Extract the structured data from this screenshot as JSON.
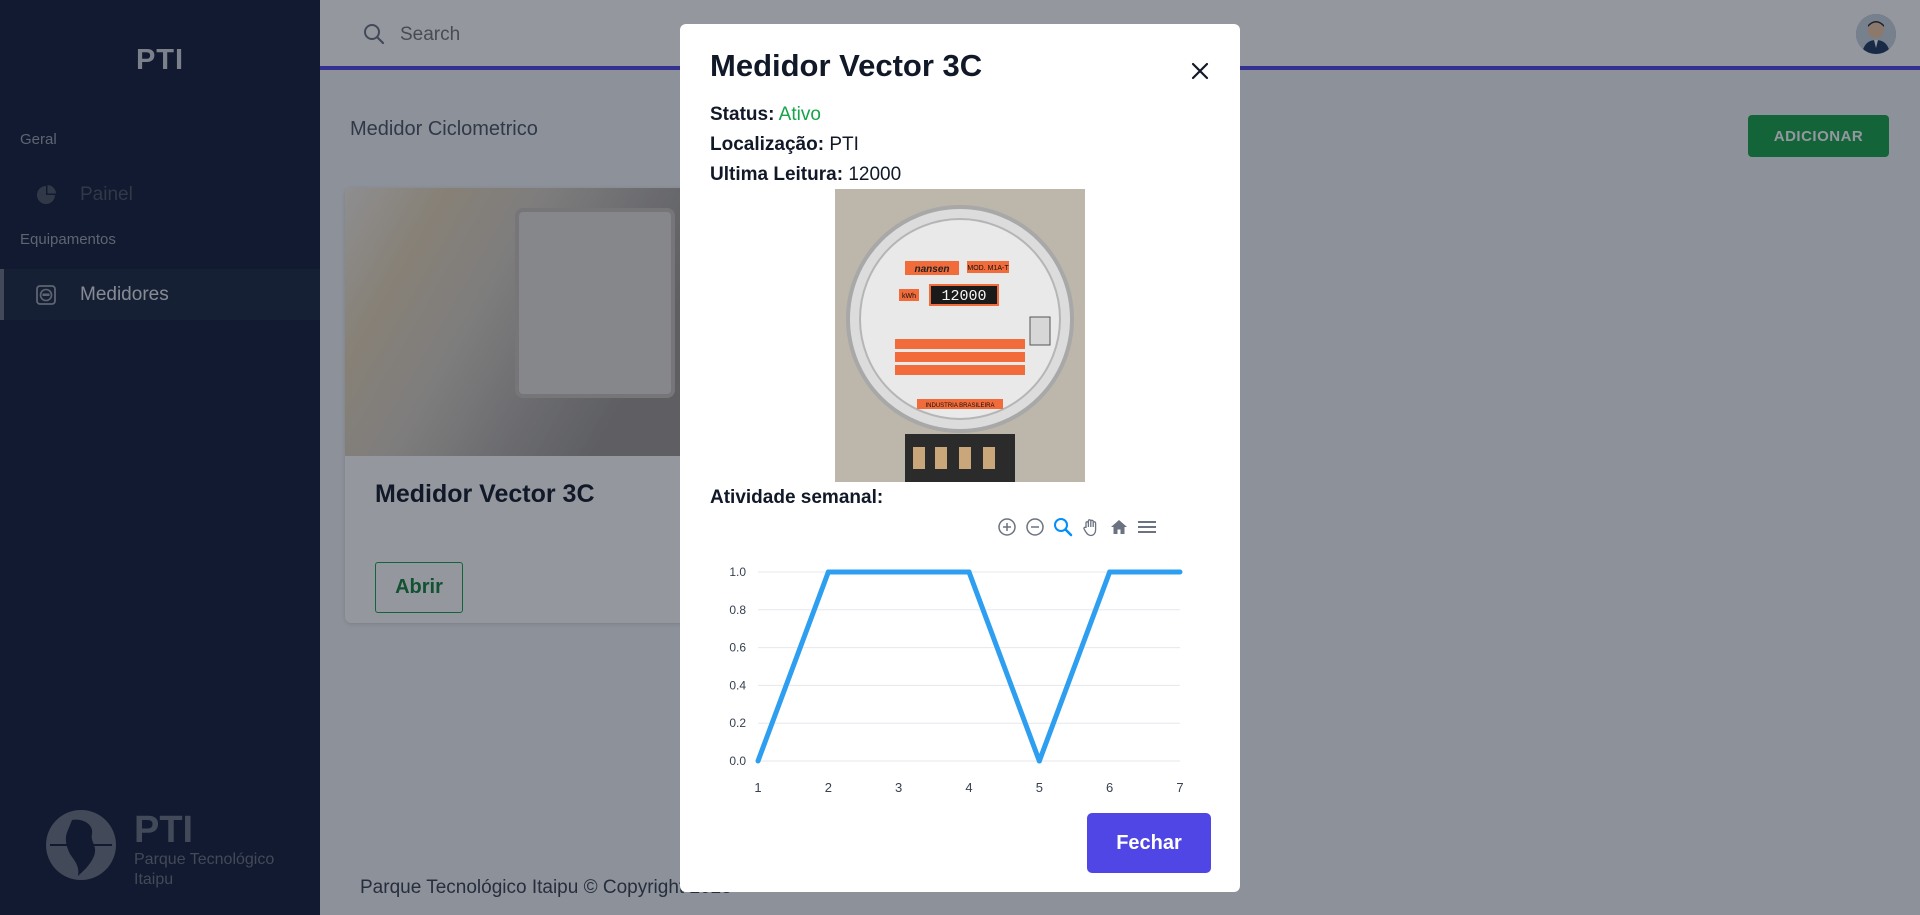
{
  "sidebar": {
    "brand": "PTI",
    "sections": [
      {
        "title": "Geral",
        "items": [
          {
            "label": "Painel",
            "icon": "pie-chart-icon",
            "state": "disabled"
          }
        ]
      },
      {
        "title": "Equipamentos",
        "items": [
          {
            "label": "Medidores",
            "icon": "meter-icon",
            "state": "active"
          }
        ]
      }
    ],
    "logo": {
      "name": "PTI",
      "line1": "Parque Tecnológico",
      "line2": "Itaipu"
    }
  },
  "header": {
    "search_placeholder": "Search",
    "accent_color": "#4f46e5"
  },
  "main": {
    "title": "Medidor Ciclometrico",
    "add_button": "ADICIONAR",
    "card": {
      "title": "Medidor Vector 3C",
      "button": "Abrir"
    },
    "footer": "Parque Tecnológico Itaipu © Copyright 2023"
  },
  "modal": {
    "title": "Medidor Vector 3C",
    "status_label": "Status:",
    "status_value": "Ativo",
    "location_label": "Localização:",
    "location_value": "PTI",
    "reading_label": "Ultima Leitura:",
    "reading_value": "12000",
    "weekly_label": "Atividade semanal:",
    "close_button": "Fechar",
    "photo_meter_reading": "12000",
    "photo_labels": {
      "brand": "nansen",
      "model": "MOD. M1A-T",
      "unit": "kWh",
      "footer": "INDUSTRIA BRASILEIRA"
    }
  },
  "chart_data": {
    "type": "line",
    "x": [
      1,
      2,
      3,
      4,
      5,
      6,
      7
    ],
    "series": [
      {
        "values": [
          0,
          1,
          1,
          1,
          0,
          1,
          1
        ],
        "color": "#2e9ff0"
      }
    ],
    "yticks": [
      "0.0",
      "0.2",
      "0.4",
      "0.6",
      "0.8",
      "1.0"
    ],
    "xticks": [
      "1",
      "2",
      "3",
      "4",
      "5",
      "6",
      "7"
    ],
    "ylim": [
      0,
      1
    ],
    "xlim": [
      1,
      7
    ],
    "grid": true,
    "toolbar": [
      "zoom-in-icon",
      "zoom-out-icon",
      "zoom-selection-icon",
      "pan-icon",
      "home-icon",
      "menu-icon"
    ]
  }
}
